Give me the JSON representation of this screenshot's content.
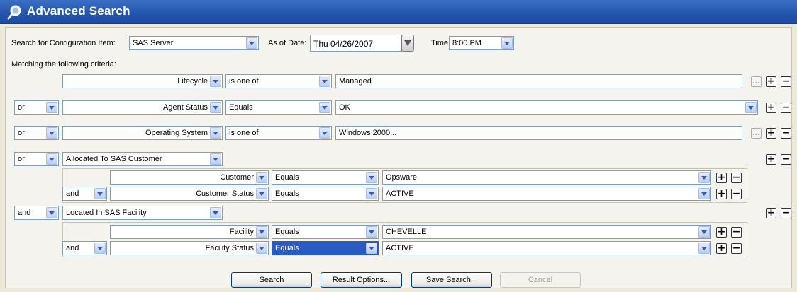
{
  "title": "Advanced Search",
  "header": {
    "search_label": "Search for Configuration Item:",
    "ci_value": "SAS Server",
    "asof_label": "As of Date:",
    "date_value": "Thu 04/26/2007",
    "time_label": "Time:",
    "time_value": "8:00 PM",
    "criteria_label": "Matching the following criteria:"
  },
  "rows": [
    {
      "field": "Lifecycle",
      "operator": "is one of",
      "value": "Managed"
    },
    {
      "conj": "or",
      "field": "Agent Status",
      "operator": "Equals",
      "value": "OK"
    },
    {
      "conj": "or",
      "field": "Operating System",
      "operator": "is one of",
      "value": "Windows 2000..."
    },
    {
      "conj": "or",
      "relation": "Allocated To SAS Customer",
      "sub": [
        {
          "field": "Customer",
          "operator": "Equals",
          "value": "Opsware"
        },
        {
          "conj": "and",
          "field": "Customer Status",
          "operator": "Equals",
          "value": "ACTIVE"
        }
      ]
    },
    {
      "conj": "and",
      "relation": "Located In SAS Facility",
      "sub": [
        {
          "field": "Facility",
          "operator": "Equals",
          "value": "CHEVELLE"
        },
        {
          "conj": "and",
          "field": "Facility Status",
          "operator": "Equals",
          "value": "ACTIVE"
        }
      ]
    }
  ],
  "buttons": {
    "search": "Search",
    "result_options": "Result Options...",
    "save_search": "Save Search...",
    "cancel": "Cancel"
  },
  "icons": {
    "add": "+",
    "remove": "−",
    "ellipsis": "…"
  }
}
